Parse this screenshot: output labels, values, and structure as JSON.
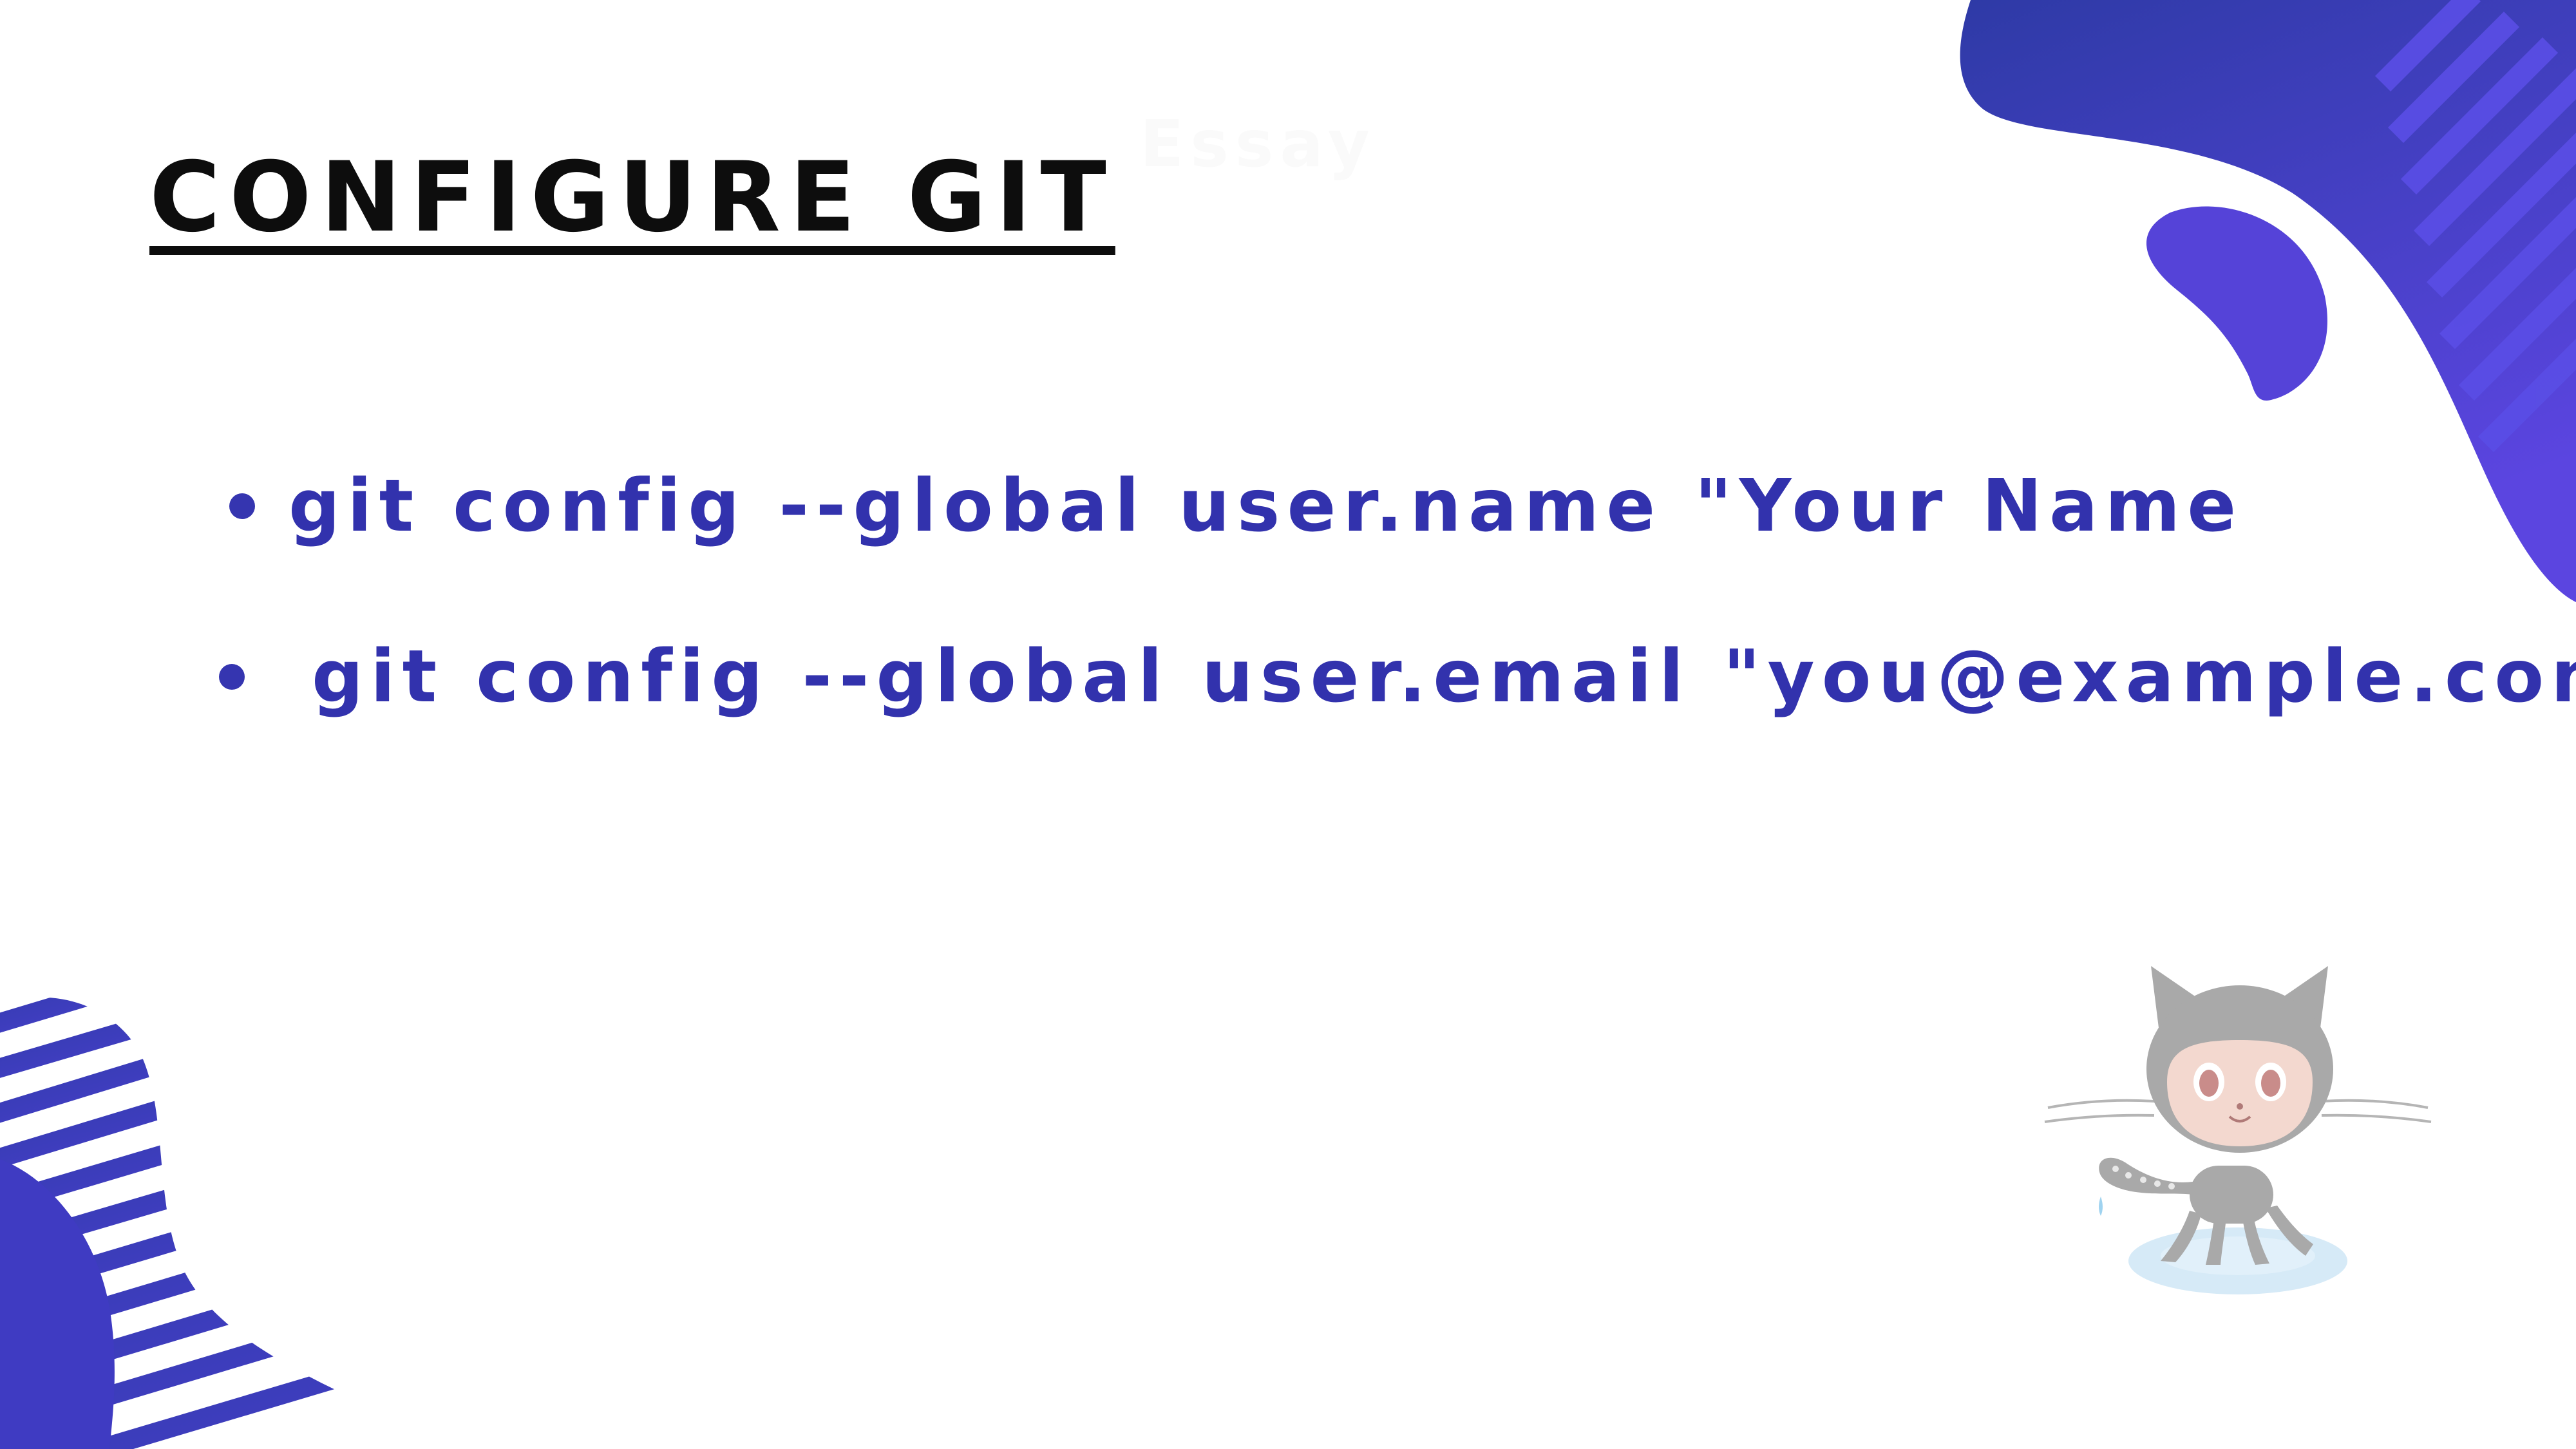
{
  "slide": {
    "title": "CONFIGURE GIT",
    "ghost_text": "Essay",
    "bullets": [
      "git config --global user.name \"Your Name",
      "git config --global user.email \"you@example.com"
    ]
  },
  "decor": {
    "octocat_icon": "octocat-icon",
    "colors": {
      "accent": "#3333b0",
      "blob_top": "#2e3aa6",
      "blob_bottom": "#5b45e0",
      "stripe": "#2f3aa8",
      "title": "#0d0d0d"
    }
  }
}
